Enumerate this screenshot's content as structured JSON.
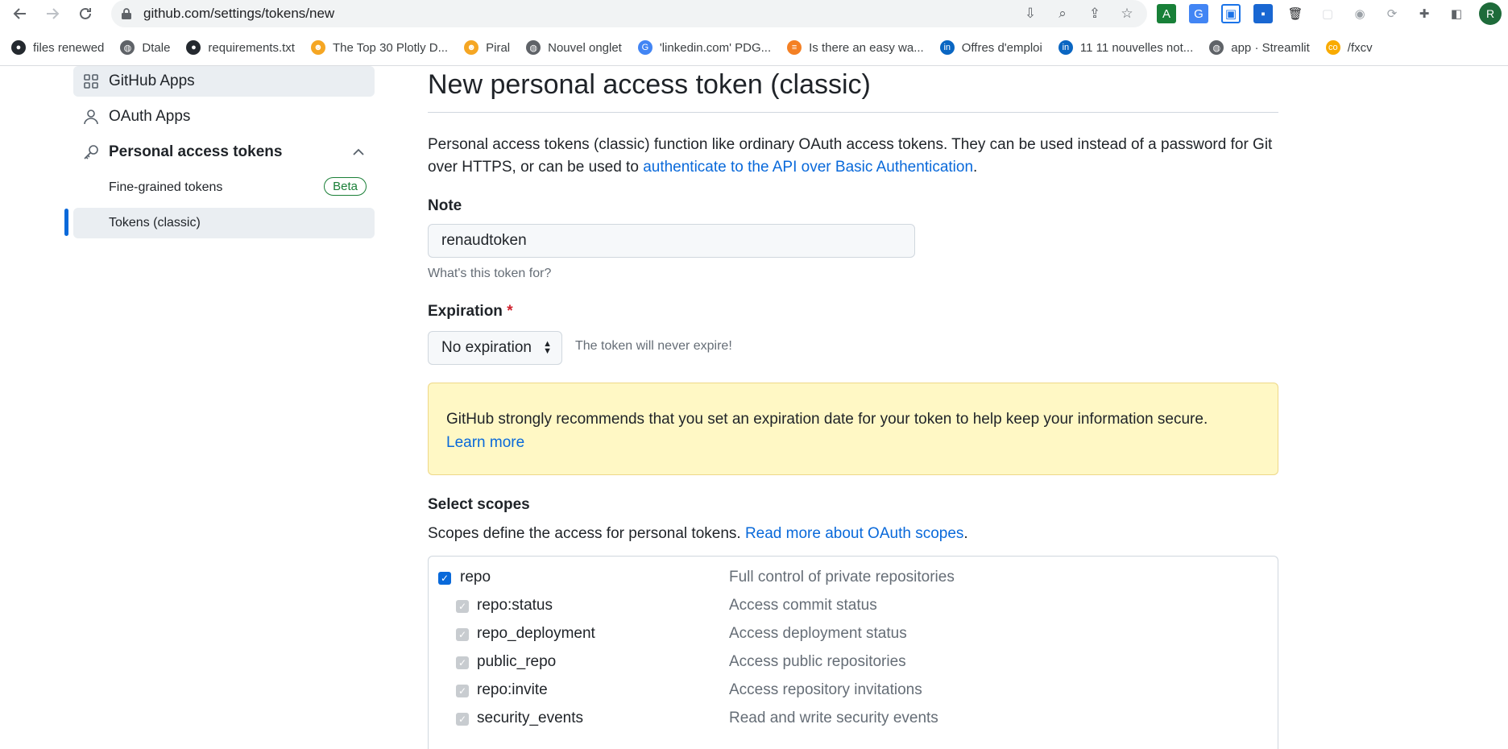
{
  "browser": {
    "url": "github.com/settings/tokens/new",
    "bookmarks": [
      {
        "label": "files renewed",
        "icon": "github-icon",
        "color": "#24292f"
      },
      {
        "label": "Dtale",
        "icon": "globe-icon",
        "color": "#5f6368"
      },
      {
        "label": "requirements.txt",
        "icon": "github-icon",
        "color": "#24292f"
      },
      {
        "label": "The Top 30 Plotly D...",
        "icon": "emoji-icon",
        "color": "#f5a623"
      },
      {
        "label": "Piral",
        "icon": "emoji-icon",
        "color": "#f5a623"
      },
      {
        "label": "Nouvel onglet",
        "icon": "globe-icon",
        "color": "#5f6368"
      },
      {
        "label": "'linkedin.com' PDG...",
        "icon": "google-icon",
        "color": "#4285f4"
      },
      {
        "label": "Is there an easy wa...",
        "icon": "stackoverflow-icon",
        "color": "#f48024"
      },
      {
        "label": "Offres d'emploi",
        "icon": "linkedin-icon",
        "color": "#0a66c2"
      },
      {
        "label": "11 11 nouvelles not...",
        "icon": "linkedin-icon",
        "color": "#0a66c2"
      },
      {
        "label": "app · Streamlit",
        "icon": "globe-icon",
        "color": "#5f6368"
      },
      {
        "label": "/fxcv",
        "icon": "colab-icon",
        "color": "#f9ab00"
      }
    ],
    "avatar_letter": "R"
  },
  "sidebar": {
    "github_apps": "GitHub Apps",
    "oauth_apps": "OAuth Apps",
    "personal_access_tokens": "Personal access tokens",
    "fine_grained": "Fine-grained tokens",
    "beta": "Beta",
    "tokens_classic": "Tokens (classic)"
  },
  "main": {
    "title": "New personal access token (classic)",
    "intro_text": "Personal access tokens (classic) function like ordinary OAuth access tokens. They can be used instead of a password for Git over HTTPS, or can be used to ",
    "intro_link": "authenticate to the API over Basic Authentication",
    "intro_end": ".",
    "note_label": "Note",
    "note_value": "renaudtoken",
    "note_hint": "What's this token for?",
    "expiration_label": "Expiration",
    "required_mark": "*",
    "expiration_value": "No expiration",
    "expiration_hint": "The token will never expire!",
    "warning_text": "GitHub strongly recommends that you set an expiration date for your token to help keep your information secure.",
    "warning_link": "Learn more",
    "scopes_label": "Select scopes",
    "scopes_text": "Scopes define the access for personal tokens. ",
    "scopes_link": "Read more about OAuth scopes",
    "scopes_end": ".",
    "scopes": [
      {
        "name": "repo",
        "desc": "Full control of private repositories",
        "checked": true,
        "child": false
      },
      {
        "name": "repo:status",
        "desc": "Access commit status",
        "checked": true,
        "child": true
      },
      {
        "name": "repo_deployment",
        "desc": "Access deployment status",
        "checked": true,
        "child": true
      },
      {
        "name": "public_repo",
        "desc": "Access public repositories",
        "checked": true,
        "child": true
      },
      {
        "name": "repo:invite",
        "desc": "Access repository invitations",
        "checked": true,
        "child": true
      },
      {
        "name": "security_events",
        "desc": "Read and write security events",
        "checked": true,
        "child": true
      }
    ]
  },
  "colors": {
    "accent": "#0969da",
    "checkbox_checked": "#0969da",
    "checkbox_disabled": "#c8ccd0",
    "warning_bg": "#fff8c5"
  }
}
